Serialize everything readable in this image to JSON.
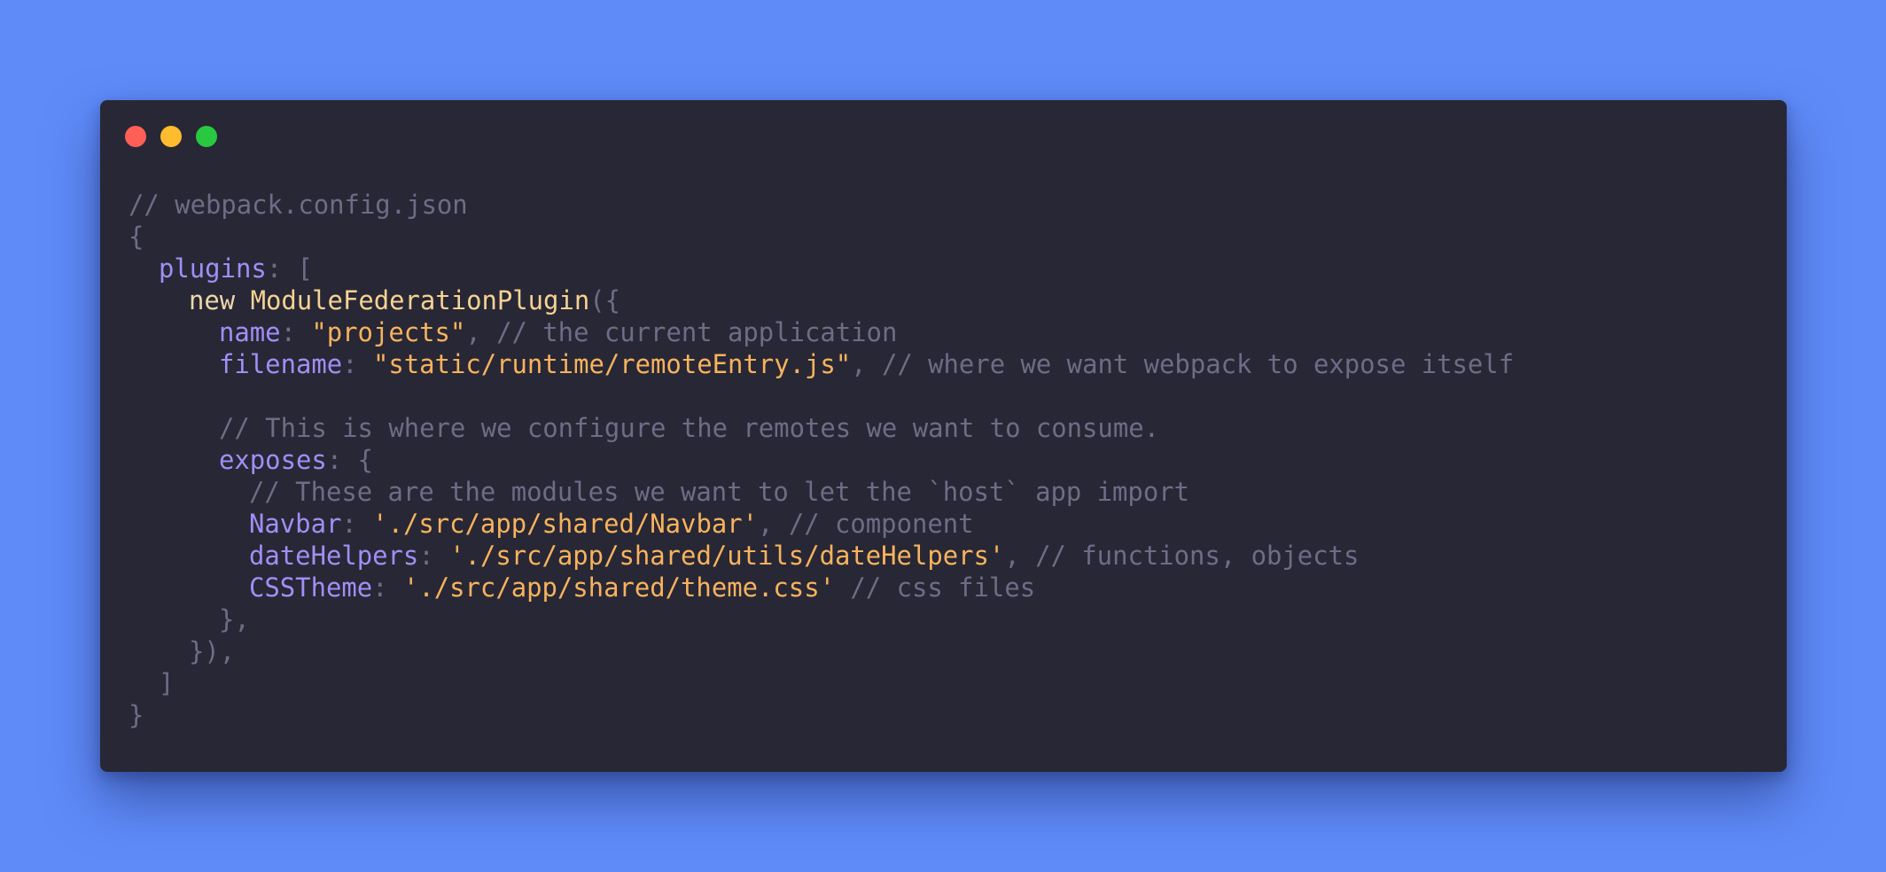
{
  "window": {
    "controls": {
      "close_color": "#ff5f57",
      "minimize_color": "#febc2e",
      "maximize_color": "#28c840"
    }
  },
  "colors": {
    "background": "#5f8bf9",
    "window": "#282735",
    "comment": "#6e6c86",
    "property": "#a18ef5",
    "string": "#f7b35e",
    "keyword": "#ecd7a9"
  },
  "code": {
    "lines": [
      {
        "indent": 0,
        "tokens": [
          {
            "t": "comment",
            "v": "// webpack.config.json"
          }
        ]
      },
      {
        "indent": 0,
        "tokens": [
          {
            "t": "punct",
            "v": "{"
          }
        ]
      },
      {
        "indent": 1,
        "tokens": [
          {
            "t": "prop",
            "v": "plugins"
          },
          {
            "t": "punct",
            "v": ": ["
          }
        ]
      },
      {
        "indent": 2,
        "tokens": [
          {
            "t": "kw",
            "v": "new "
          },
          {
            "t": "cls",
            "v": "ModuleFederationPlugin"
          },
          {
            "t": "punct",
            "v": "({"
          }
        ]
      },
      {
        "indent": 3,
        "tokens": [
          {
            "t": "prop",
            "v": "name"
          },
          {
            "t": "punct",
            "v": ": "
          },
          {
            "t": "str",
            "v": "\"projects\""
          },
          {
            "t": "punct",
            "v": ", "
          },
          {
            "t": "comment",
            "v": "// the current application"
          }
        ]
      },
      {
        "indent": 3,
        "tokens": [
          {
            "t": "prop",
            "v": "filename"
          },
          {
            "t": "punct",
            "v": ": "
          },
          {
            "t": "str",
            "v": "\"static/runtime/remoteEntry.js\""
          },
          {
            "t": "punct",
            "v": ", "
          },
          {
            "t": "comment",
            "v": "// where we want webpack to expose itself"
          }
        ]
      },
      {
        "indent": 0,
        "tokens": []
      },
      {
        "indent": 3,
        "tokens": [
          {
            "t": "comment",
            "v": "// This is where we configure the remotes we want to consume."
          }
        ]
      },
      {
        "indent": 3,
        "tokens": [
          {
            "t": "prop",
            "v": "exposes"
          },
          {
            "t": "punct",
            "v": ": {"
          }
        ]
      },
      {
        "indent": 4,
        "tokens": [
          {
            "t": "comment",
            "v": "// These are the modules we want to let the `host` app import"
          }
        ]
      },
      {
        "indent": 4,
        "tokens": [
          {
            "t": "prop",
            "v": "Navbar"
          },
          {
            "t": "punct",
            "v": ": "
          },
          {
            "t": "str",
            "v": "'./src/app/shared/Navbar'"
          },
          {
            "t": "punct",
            "v": ", "
          },
          {
            "t": "comment",
            "v": "// component"
          }
        ]
      },
      {
        "indent": 4,
        "tokens": [
          {
            "t": "prop",
            "v": "dateHelpers"
          },
          {
            "t": "punct",
            "v": ": "
          },
          {
            "t": "str",
            "v": "'./src/app/shared/utils/dateHelpers'"
          },
          {
            "t": "punct",
            "v": ", "
          },
          {
            "t": "comment",
            "v": "// functions, objects"
          }
        ]
      },
      {
        "indent": 4,
        "tokens": [
          {
            "t": "prop",
            "v": "CSSTheme"
          },
          {
            "t": "punct",
            "v": ": "
          },
          {
            "t": "str",
            "v": "'./src/app/shared/theme.css'"
          },
          {
            "t": "punct",
            "v": " "
          },
          {
            "t": "comment",
            "v": "// css files"
          }
        ]
      },
      {
        "indent": 3,
        "tokens": [
          {
            "t": "punct",
            "v": "},"
          }
        ]
      },
      {
        "indent": 2,
        "tokens": [
          {
            "t": "punct",
            "v": "}),"
          }
        ]
      },
      {
        "indent": 1,
        "tokens": [
          {
            "t": "punct",
            "v": "]"
          }
        ]
      },
      {
        "indent": 0,
        "tokens": [
          {
            "t": "punct",
            "v": "}"
          }
        ]
      }
    ]
  }
}
